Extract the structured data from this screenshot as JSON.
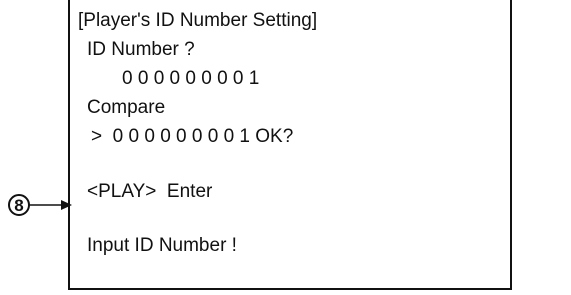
{
  "screen": {
    "title": "[Player's ID Number Setting]",
    "id_prompt": "ID Number ?",
    "id_value": "0 0 0 0 0 0 0 0 1",
    "compare_label": "Compare",
    "compare_value": ">  0 0 0 0 0 0 0 0 1 OK?",
    "enter_instruction": "<PLAY>  Enter",
    "input_prompt": "Input ID Number !"
  },
  "callout": {
    "label": "8"
  }
}
